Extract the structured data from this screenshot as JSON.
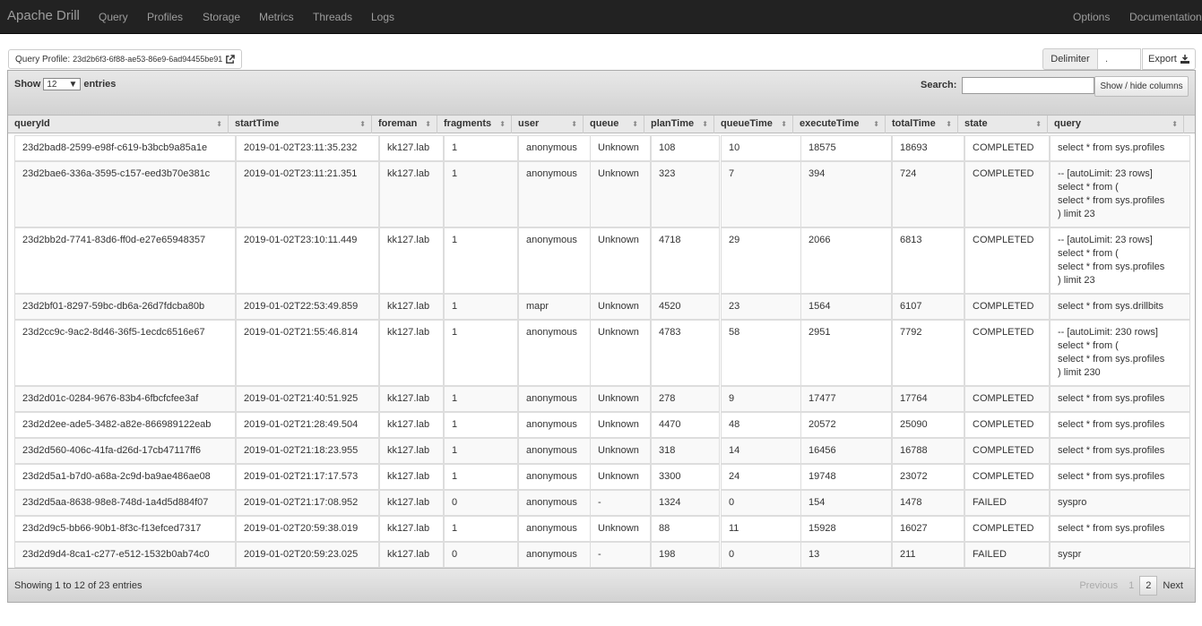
{
  "navbar": {
    "brand": "Apache Drill",
    "items": [
      "Query",
      "Profiles",
      "Storage",
      "Metrics",
      "Threads",
      "Logs"
    ],
    "right_items": [
      "Options",
      "Documentation"
    ]
  },
  "profile": {
    "label": "Query Profile:",
    "id": "23d2b6f3-6f88-ae53-86e9-6ad94455be91"
  },
  "delimiter": {
    "label": "Delimiter",
    "value": "."
  },
  "export": {
    "label": "Export"
  },
  "table_controls": {
    "show_prefix": "Show",
    "page_length": "12",
    "show_suffix": "entries",
    "search_label": "Search:",
    "search_value": "",
    "columns_button": "Show / hide columns"
  },
  "columns": [
    "queryId",
    "startTime",
    "foreman",
    "fragments",
    "user",
    "queue",
    "planTime",
    "queueTime",
    "executeTime",
    "totalTime",
    "state",
    "query"
  ],
  "rows": [
    [
      "23d2bad8-2599-e98f-c619-b3bcb9a85a1e",
      "2019-01-02T23:11:35.232",
      "kk127.lab",
      "1",
      "anonymous",
      "Unknown",
      "108",
      "10",
      "18575",
      "18693",
      "COMPLETED",
      "select * from sys.profiles"
    ],
    [
      "23d2bae6-336a-3595-c157-eed3b70e381c",
      "2019-01-02T23:11:21.351",
      "kk127.lab",
      "1",
      "anonymous",
      "Unknown",
      "323",
      "7",
      "394",
      "724",
      "COMPLETED",
      "-- [autoLimit: 23 rows]\nselect * from (\nselect * from sys.profiles\n) limit 23"
    ],
    [
      "23d2bb2d-7741-83d6-ff0d-e27e65948357",
      "2019-01-02T23:10:11.449",
      "kk127.lab",
      "1",
      "anonymous",
      "Unknown",
      "4718",
      "29",
      "2066",
      "6813",
      "COMPLETED",
      "-- [autoLimit: 23 rows]\nselect * from (\nselect * from sys.profiles\n) limit 23"
    ],
    [
      "23d2bf01-8297-59bc-db6a-26d7fdcba80b",
      "2019-01-02T22:53:49.859",
      "kk127.lab",
      "1",
      "mapr",
      "Unknown",
      "4520",
      "23",
      "1564",
      "6107",
      "COMPLETED",
      "select * from sys.drillbits"
    ],
    [
      "23d2cc9c-9ac2-8d46-36f5-1ecdc6516e67",
      "2019-01-02T21:55:46.814",
      "kk127.lab",
      "1",
      "anonymous",
      "Unknown",
      "4783",
      "58",
      "2951",
      "7792",
      "COMPLETED",
      "-- [autoLimit: 230 rows]\nselect * from (\nselect * from sys.profiles\n) limit 230"
    ],
    [
      "23d2d01c-0284-9676-83b4-6fbcfcfee3af",
      "2019-01-02T21:40:51.925",
      "kk127.lab",
      "1",
      "anonymous",
      "Unknown",
      "278",
      "9",
      "17477",
      "17764",
      "COMPLETED",
      "select * from sys.profiles"
    ],
    [
      "23d2d2ee-ade5-3482-a82e-866989122eab",
      "2019-01-02T21:28:49.504",
      "kk127.lab",
      "1",
      "anonymous",
      "Unknown",
      "4470",
      "48",
      "20572",
      "25090",
      "COMPLETED",
      "select * from sys.profiles"
    ],
    [
      "23d2d560-406c-41fa-d26d-17cb47117ff6",
      "2019-01-02T21:18:23.955",
      "kk127.lab",
      "1",
      "anonymous",
      "Unknown",
      "318",
      "14",
      "16456",
      "16788",
      "COMPLETED",
      "select * from sys.profiles"
    ],
    [
      "23d2d5a1-b7d0-a68a-2c9d-ba9ae486ae08",
      "2019-01-02T21:17:17.573",
      "kk127.lab",
      "1",
      "anonymous",
      "Unknown",
      "3300",
      "24",
      "19748",
      "23072",
      "COMPLETED",
      "select * from sys.profiles"
    ],
    [
      "23d2d5aa-8638-98e8-748d-1a4d5d884f07",
      "2019-01-02T21:17:08.952",
      "kk127.lab",
      "0",
      "anonymous",
      "-",
      "1324",
      "0",
      "154",
      "1478",
      "FAILED",
      "syspro"
    ],
    [
      "23d2d9c5-bb66-90b1-8f3c-f13efced7317",
      "2019-01-02T20:59:38.019",
      "kk127.lab",
      "1",
      "anonymous",
      "Unknown",
      "88",
      "11",
      "15928",
      "16027",
      "COMPLETED",
      "select * from sys.profiles"
    ],
    [
      "23d2d9d4-8ca1-c277-e512-1532b0ab74c0",
      "2019-01-02T20:59:23.025",
      "kk127.lab",
      "0",
      "anonymous",
      "-",
      "198",
      "0",
      "13",
      "211",
      "FAILED",
      "syspr"
    ]
  ],
  "footer": {
    "info": "Showing 1 to 12 of 23 entries",
    "previous": "Previous",
    "pages": [
      "1",
      "2"
    ],
    "next": "Next"
  }
}
